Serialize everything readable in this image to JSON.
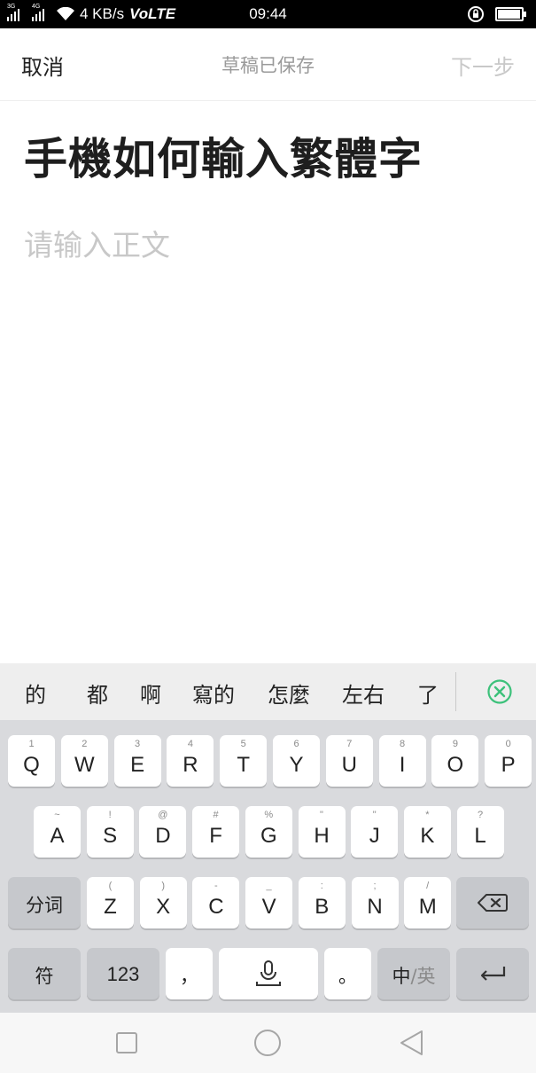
{
  "status_bar": {
    "net_tags": [
      "3G",
      "4G"
    ],
    "speed": "4 KB/s",
    "volte": "VoLTE",
    "time": "09:44",
    "battery_level": 0.95
  },
  "header": {
    "cancel": "取消",
    "draft_status": "草稿已保存",
    "next": "下一步"
  },
  "editor": {
    "title": "手機如何輸入繁體字",
    "body_placeholder": "请输入正文"
  },
  "keyboard": {
    "candidates": [
      "的",
      "都",
      "啊",
      "寫的",
      "怎麼",
      "左右",
      "了"
    ],
    "row1": [
      {
        "hint": "1",
        "label": "Q"
      },
      {
        "hint": "2",
        "label": "W"
      },
      {
        "hint": "3",
        "label": "E"
      },
      {
        "hint": "4",
        "label": "R"
      },
      {
        "hint": "5",
        "label": "T"
      },
      {
        "hint": "6",
        "label": "Y"
      },
      {
        "hint": "7",
        "label": "U"
      },
      {
        "hint": "8",
        "label": "I"
      },
      {
        "hint": "9",
        "label": "O"
      },
      {
        "hint": "0",
        "label": "P"
      }
    ],
    "row2": [
      {
        "hint": "~",
        "label": "A"
      },
      {
        "hint": "!",
        "label": "S"
      },
      {
        "hint": "@",
        "label": "D"
      },
      {
        "hint": "#",
        "label": "F"
      },
      {
        "hint": "%",
        "label": "G"
      },
      {
        "hint": "\"",
        "label": "H"
      },
      {
        "hint": "\"",
        "label": "J"
      },
      {
        "hint": "*",
        "label": "K"
      },
      {
        "hint": "?",
        "label": "L"
      }
    ],
    "row3": [
      {
        "hint": "(",
        "label": "Z"
      },
      {
        "hint": ")",
        "label": "X"
      },
      {
        "hint": "-",
        "label": "C"
      },
      {
        "hint": "_",
        "label": "V"
      },
      {
        "hint": ":",
        "label": "B"
      },
      {
        "hint": ";",
        "label": "N"
      },
      {
        "hint": "/",
        "label": "M"
      }
    ],
    "segment_key": "分词",
    "symbol_key": "符",
    "number_key": "123",
    "comma_key": "，",
    "period_key": "。",
    "lang_zh": "中",
    "lang_sep": "/",
    "lang_en": "英"
  },
  "colors": {
    "accent_green": "#3cc17a",
    "placeholder_gray": "#c8c8c8"
  }
}
